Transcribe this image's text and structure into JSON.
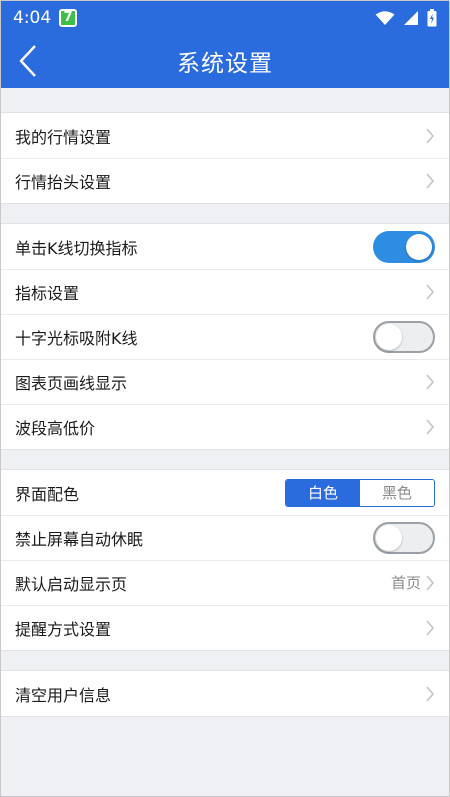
{
  "status_bar": {
    "time": "4:04",
    "app_badge": "7"
  },
  "header": {
    "title": "系统设置"
  },
  "groups": [
    {
      "rows": [
        {
          "label": "我的行情设置"
        },
        {
          "label": "行情抬头设置"
        }
      ]
    },
    {
      "rows": [
        {
          "label": "单击K线切换指标",
          "toggle": "on"
        },
        {
          "label": "指标设置"
        },
        {
          "label": "十字光标吸附K线",
          "toggle": "off"
        },
        {
          "label": "图表页画线显示"
        },
        {
          "label": "波段高低价"
        }
      ]
    },
    {
      "rows": [
        {
          "label": "界面配色",
          "options": [
            "白色",
            "黑色"
          ],
          "selected": "白色"
        },
        {
          "label": "禁止屏幕自动休眠",
          "toggle": "off"
        },
        {
          "label": "默认启动显示页",
          "value": "首页"
        },
        {
          "label": "提醒方式设置"
        }
      ]
    },
    {
      "rows": [
        {
          "label": "清空用户信息"
        }
      ]
    }
  ],
  "colors": {
    "header_blue": "#2a6bde",
    "toggle_on": "#2e8de2",
    "background": "#eff0f4"
  }
}
